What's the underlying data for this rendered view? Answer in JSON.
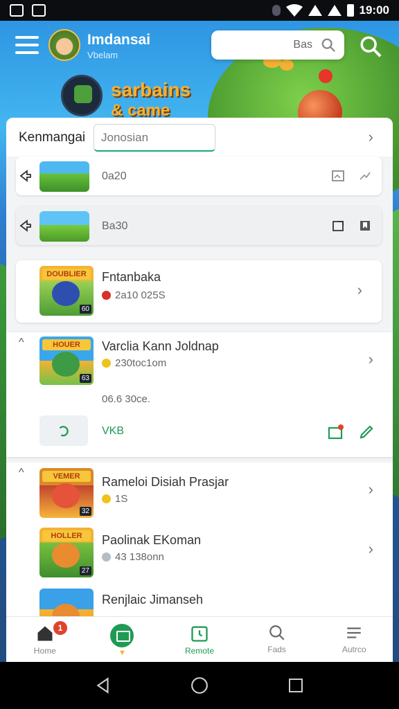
{
  "status_bar": {
    "time": "19:00"
  },
  "header": {
    "app_title": "Imdansai",
    "app_subtitle": "Vbelam",
    "search_value": "Bas",
    "promo_line1": "sarbains",
    "promo_line2": "& came"
  },
  "filter": {
    "label": "Kenmangai",
    "input_value": "Jonosian"
  },
  "list": {
    "compact_rows": [
      {
        "text": "0a20"
      },
      {
        "text": "Ba30"
      }
    ],
    "games": [
      {
        "title": "Fntanbaka",
        "meta": "2a10 025S",
        "badge_color": "red",
        "thumb_banner": "DOUBLIER",
        "thumb_corner": "60"
      },
      {
        "title": "Varclia Kann Joldnap",
        "meta": "230toc1om",
        "badge_color": "yellow",
        "thumb_banner": "HOUER",
        "thumb_corner": "63"
      },
      {
        "title": "Rameloi Disiah Prasjar",
        "meta": "1S",
        "badge_color": "yellow",
        "thumb_banner": "VEMER",
        "thumb_corner": "32"
      },
      {
        "title": "Paolinak EKoman",
        "meta": "43 138onn",
        "badge_color": "grey",
        "thumb_banner": "HOLLER",
        "thumb_corner": "27"
      },
      {
        "title": "Renjlaic Jimanseh",
        "meta": "",
        "badge_color": "yellow",
        "thumb_banner": "",
        "thumb_corner": ""
      }
    ],
    "expanded": {
      "desc": "06.6 30ce.",
      "action_label": "VKB"
    }
  },
  "bottom_nav": {
    "items": [
      {
        "label": "Home",
        "icon": "home-icon",
        "badge": "1"
      },
      {
        "label": "",
        "icon": "store-icon",
        "active": false
      },
      {
        "label": "Remote",
        "icon": "calendar-icon",
        "active": true
      },
      {
        "label": "Fads",
        "icon": "search-icon"
      },
      {
        "label": "Autrco",
        "icon": "list-icon"
      }
    ]
  },
  "colors": {
    "accent": "#1f9b55",
    "background_sky": "#2f7fd0",
    "badge_red": "#e0432c"
  }
}
